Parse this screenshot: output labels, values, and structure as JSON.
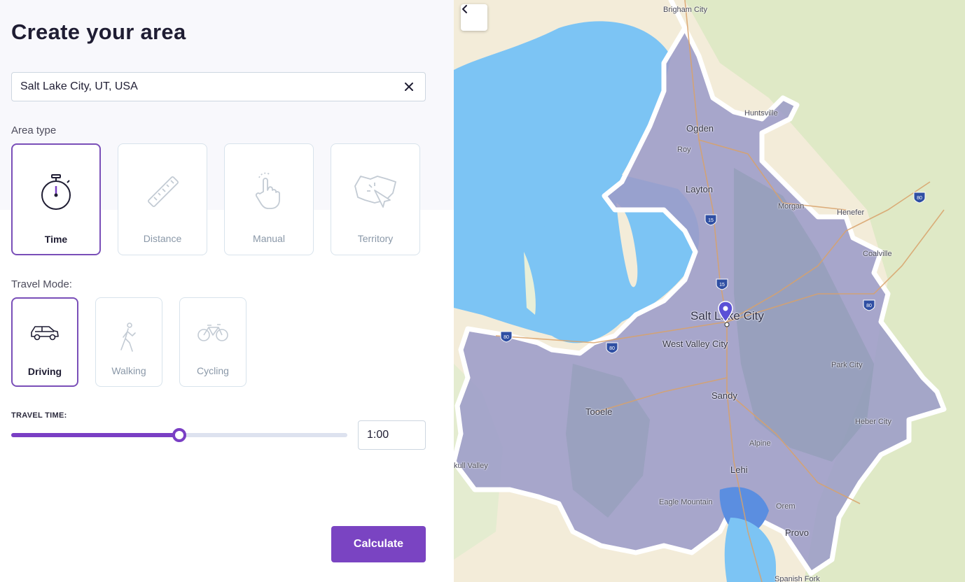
{
  "panel": {
    "title": "Create your area",
    "search": {
      "value": "Salt Lake City, UT, USA"
    },
    "area_type_label": "Area type",
    "area_types": [
      {
        "label": "Time",
        "icon": "stopwatch-icon",
        "selected": true
      },
      {
        "label": "Distance",
        "icon": "ruler-icon",
        "selected": false
      },
      {
        "label": "Manual",
        "icon": "hand-pointer-icon",
        "selected": false
      },
      {
        "label": "Territory",
        "icon": "territory-cursor-icon",
        "selected": false
      }
    ],
    "travel_mode_label": "Travel Mode:",
    "travel_modes": [
      {
        "label": "Driving",
        "icon": "car-icon",
        "selected": true
      },
      {
        "label": "Walking",
        "icon": "walking-icon",
        "selected": false
      },
      {
        "label": "Cycling",
        "icon": "bicycle-icon",
        "selected": false
      }
    ],
    "travel_time_label": "TRAVEL TIME:",
    "travel_time_value": "1:00",
    "travel_time_fraction": 0.5,
    "calculate_label": "Calculate",
    "accent_color": "#7a44c2"
  },
  "map": {
    "labels": {
      "brigham": "Brigham City",
      "huntsville": "Huntsville",
      "ogden": "Ogden",
      "roy": "Roy",
      "layton": "Layton",
      "morgan": "Morgan",
      "henefer": "Henefer",
      "coalville": "Coalville",
      "slc": "Salt Lake City",
      "wvc": "West Valley City",
      "park_city": "Park City",
      "sandy": "Sandy",
      "tooele": "Tooele",
      "heber": "Heber City",
      "alpine": "Alpine",
      "lehi": "Lehi",
      "rush_valley": "kull Valley",
      "eagle_mountain": "Eagle Mountain",
      "orem": "Orem",
      "provo": "Provo",
      "spanish_fork": "Spanish Fork"
    },
    "highway_shields": [
      "80",
      "15",
      "15",
      "80",
      "80",
      "80"
    ],
    "colors": {
      "land": "#f3ecd9",
      "water": "#7cc4f4",
      "isochrone": "#9c9cc8",
      "marker": "#5b50d6"
    }
  }
}
